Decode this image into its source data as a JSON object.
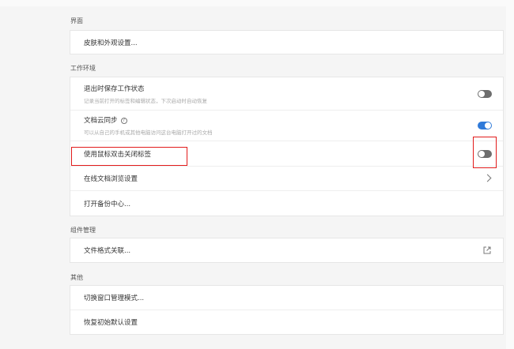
{
  "sections": [
    {
      "label": "界面",
      "rows": [
        {
          "title": "皮肤和外观设置..."
        }
      ]
    },
    {
      "label": "工作环境",
      "rows": [
        {
          "title": "退出时保存工作状态",
          "subtitle": "记录当前打开的标签和编辑状态，下次启动时自动恢复",
          "toggle": false
        },
        {
          "title": "文档云同步",
          "subtitle": "可以从自己的手机或其他电脑访问这台电脑打开过的文档",
          "toggle": true,
          "help_icon": "?"
        },
        {
          "title": "使用鼠标双击关闭标签",
          "toggle": false
        },
        {
          "title": "在线文档浏览设置"
        },
        {
          "title": "打开备份中心..."
        }
      ]
    },
    {
      "label": "组件管理",
      "rows": [
        {
          "title": "文件格式关联..."
        }
      ]
    },
    {
      "label": "其他",
      "rows": [
        {
          "title": "切换窗口管理模式..."
        },
        {
          "title": "恢复初始默认设置"
        }
      ]
    }
  ],
  "colors": {
    "toggle_on": "#2f7ad9",
    "toggle_off": "#6d6d6d",
    "highlight": "#e21b1b"
  }
}
